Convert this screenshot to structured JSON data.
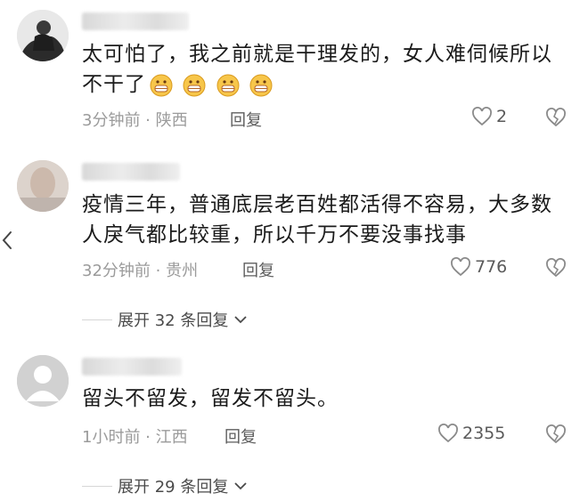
{
  "comments": [
    {
      "text_lines": [
        "太可怕了，我之前就是干理发的，女人难伺候所以",
        "不干了"
      ],
      "emoji_count": 4,
      "emoji_name": "grimace-emoji",
      "meta": "3分钟前 · 陕西",
      "reply_label": "回复",
      "likes": "2"
    },
    {
      "text_lines": [
        "疫情三年，普通底层老百姓都活得不容易，大多数",
        "人戾气都比较重，所以千万不要没事找事"
      ],
      "meta": "32分钟前 · 贵州",
      "reply_label": "回复",
      "likes": "776",
      "expand_label": "展开 32 条回复"
    },
    {
      "text_lines": [
        "留头不留发，留发不留头。"
      ],
      "meta": "1小时前 · 江西",
      "reply_label": "回复",
      "likes": "2355",
      "expand_label": "展开 29 条回复"
    }
  ],
  "colors": {
    "text": "#1b1b1b",
    "meta": "#9b9b9b",
    "icon": "#8a8a8a",
    "emoji_face": "#f7c64a"
  },
  "icons": [
    "heart-icon",
    "broken-heart-icon",
    "chevron-down-icon",
    "chevron-left-icon"
  ]
}
